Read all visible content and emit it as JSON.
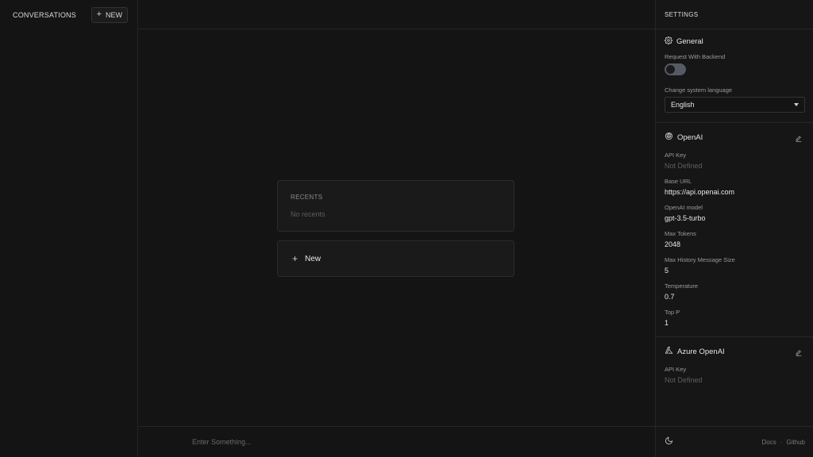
{
  "sidebar": {
    "title": "CONVERSATIONS",
    "new_label": "NEW"
  },
  "main": {
    "recents_label": "RECENTS",
    "recents_empty": "No recents",
    "new_label": "New",
    "input_placeholder": "Enter Something..."
  },
  "settings": {
    "title": "SETTINGS",
    "general": {
      "title": "General",
      "request_backend_label": "Request With Backend",
      "request_backend_enabled": false,
      "language_label": "Change system language",
      "language_value": "English"
    },
    "openai": {
      "title": "OpenAI",
      "fields": [
        {
          "label": "API Key",
          "value": "Not Defined",
          "muted": true
        },
        {
          "label": "Base URL",
          "value": "https://api.openai.com",
          "muted": false
        },
        {
          "label": "OpenAI model",
          "value": "gpt-3.5-turbo",
          "muted": false
        },
        {
          "label": "Max Tokens",
          "value": "2048",
          "muted": false
        },
        {
          "label": "Max History Message Size",
          "value": "5",
          "muted": false
        },
        {
          "label": "Temperature",
          "value": "0.7",
          "muted": false
        },
        {
          "label": "Top P",
          "value": "1",
          "muted": false
        }
      ]
    },
    "azure": {
      "title": "Azure OpenAI",
      "fields": [
        {
          "label": "API Key",
          "value": "Not Defined",
          "muted": true
        }
      ]
    }
  },
  "footer": {
    "docs": "Docs",
    "separator": "·",
    "github": "Github"
  },
  "icons": {
    "plus": "plus-icon",
    "gear": "gear-icon",
    "openai": "openai-logo-icon",
    "azure": "azure-logo-icon",
    "edit": "pencil-icon",
    "moon": "moon-icon",
    "caret": "caret-down-icon"
  },
  "colors": {
    "background": "#141414",
    "panel": "#161616",
    "card": "#1a1a1a",
    "border": "#262626",
    "text": "#e6e6e6",
    "muted": "#5f5f5f"
  }
}
